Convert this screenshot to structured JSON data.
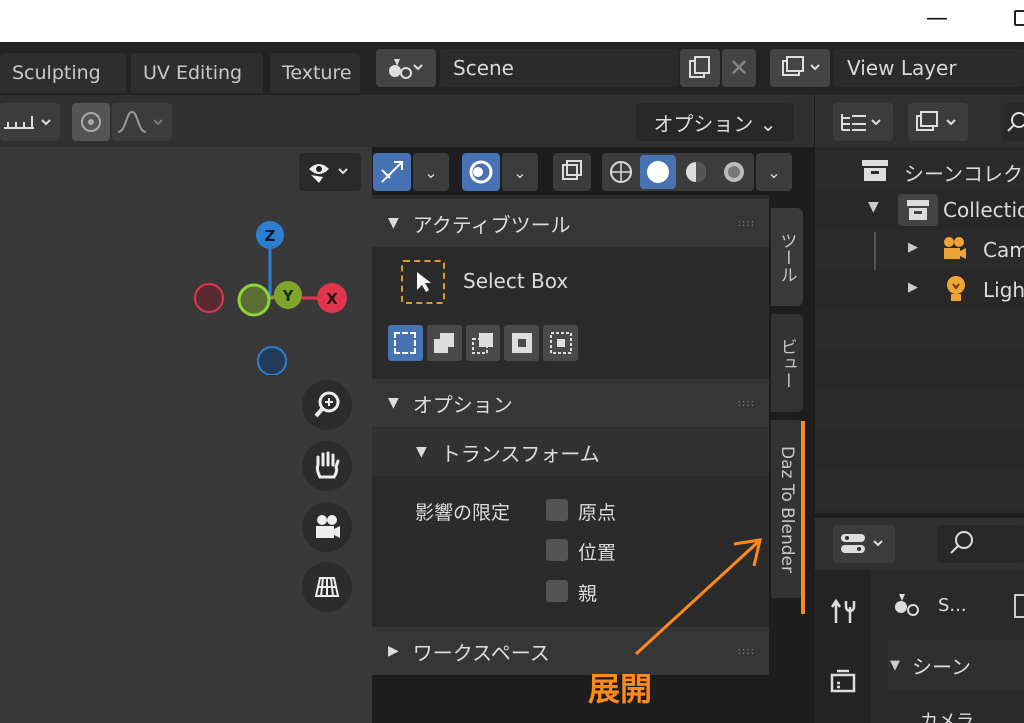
{
  "window": {
    "minimize_glyph": "—"
  },
  "workspaces": [
    "Sculpting",
    "UV Editing",
    "Texture"
  ],
  "scene": {
    "name": "Scene",
    "icon": "scene-icon"
  },
  "view_layer": {
    "name": "View Layer",
    "icon": "render-layer-icon"
  },
  "viewport_header": {
    "options_label": "オプション ⌄",
    "buttons": [
      "visibility-icon",
      "gizmo-toggle-icon",
      "overlay-icon",
      "xray-icon",
      "wireframe-shading-icon",
      "solid-shading-icon",
      "material-shading-icon",
      "rendered-shading-icon"
    ]
  },
  "nav_gizmo": {
    "z": "Z",
    "y": "Y",
    "x": "X"
  },
  "nav_buttons": [
    "zoom-icon",
    "hand-pan-icon",
    "camera-icon",
    "grid-icon"
  ],
  "npanel": {
    "active_tool": {
      "header": "アクティブツール",
      "tool_name": "Select Box"
    },
    "options": {
      "header": "オプション"
    },
    "transform": {
      "header": "トランスフォーム",
      "affect_label": "影響の限定",
      "checkboxes": [
        "原点",
        "位置",
        "親"
      ]
    },
    "workspace": {
      "header": "ワークスペース"
    },
    "grip": "::::"
  },
  "side_tabs": [
    "ツール",
    "ビュー",
    "Daz To Blender"
  ],
  "annotation": {
    "text": "展開",
    "color": "#ff8a1a"
  },
  "outliner": {
    "scene_collection": "シーンコレク",
    "collection": "Collectio",
    "items": [
      "Cam",
      "Ligh"
    ]
  },
  "properties": {
    "scene_short": "S...",
    "scene_header": "シーン",
    "camera_label": "カメラ"
  },
  "colors": {
    "accent_blue": "#4772b3",
    "axis_x": "#e0354f",
    "axis_y": "#7fa52c",
    "axis_z": "#2c7fd1",
    "annotation": "#ff8a1a"
  }
}
